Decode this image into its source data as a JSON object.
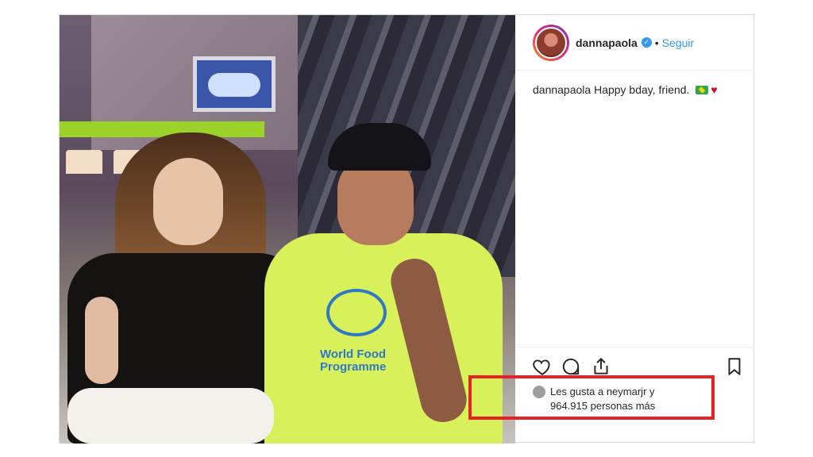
{
  "post": {
    "username": "dannapaola",
    "separator": "•",
    "follow_label": "Seguir",
    "caption_user": "dannapaola",
    "caption_text": "Happy bday, friend.",
    "photo_text": "World Food Programme",
    "likes_line1": "Les gusta a neymarjr y",
    "likes_line2": "964.915 personas más"
  },
  "icons": {
    "like": "heart-outline-icon",
    "comment": "comment-icon",
    "share": "share-icon",
    "save": "bookmark-icon",
    "verified": "verified-badge-icon",
    "flag": "brazil-flag-emoji",
    "heart": "red-heart-emoji"
  },
  "colors": {
    "link": "#3897f0",
    "highlight_border": "#e32424",
    "heart_emoji": "#c4122f"
  }
}
